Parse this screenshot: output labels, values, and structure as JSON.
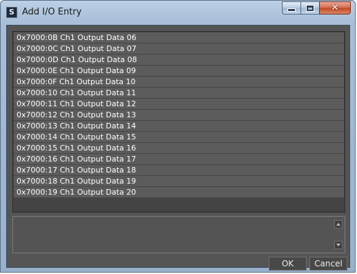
{
  "window": {
    "title": "Add I/O Entry",
    "icon": "app-icon",
    "controls": {
      "minimize": "minimize-icon",
      "maximize": "maximize-icon",
      "close_glyph": "✕"
    }
  },
  "entries": [
    "0x7000:0B Ch1 Output Data 06",
    "0x7000:0C Ch1 Output Data 07",
    "0x7000:0D Ch1 Output Data 08",
    "0x7000:0E Ch1 Output Data 09",
    "0x7000:0F Ch1 Output Data 10",
    "0x7000:10 Ch1 Output Data 11",
    "0x7000:11 Ch1 Output Data 12",
    "0x7000:12 Ch1 Output Data 13",
    "0x7000:13 Ch1 Output Data 14",
    "0x7000:14 Ch1 Output Data 15",
    "0x7000:15 Ch1 Output Data 16",
    "0x7000:16 Ch1 Output Data 17",
    "0x7000:17 Ch1 Output Data 18",
    "0x7000:18 Ch1 Output Data 19",
    "0x7000:19 Ch1 Output Data 20"
  ],
  "description": "",
  "buttons": {
    "ok": "OK",
    "cancel": "Cancel"
  },
  "colors": {
    "dialog_background": "#555555",
    "row_background": "#5c5c5c",
    "text": "#ffffff",
    "close_button": "#c2441f"
  }
}
